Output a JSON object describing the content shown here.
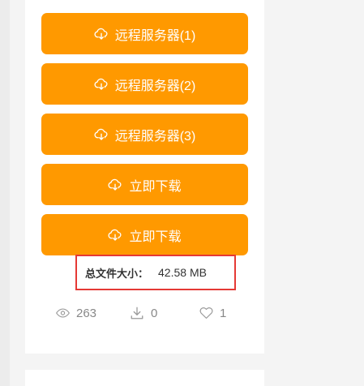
{
  "download_buttons": [
    {
      "label": "远程服务器(1)"
    },
    {
      "label": "远程服务器(2)"
    },
    {
      "label": "远程服务器(3)"
    },
    {
      "label": "立即下载"
    },
    {
      "label": "立即下载"
    }
  ],
  "file_info": {
    "size_label": "总文件大小：",
    "size_value": "42.58 MB"
  },
  "stats": {
    "views": "263",
    "downloads": "0",
    "likes": "1"
  },
  "colors": {
    "button_bg": "#ff9900",
    "highlight_border": "#e53935"
  }
}
